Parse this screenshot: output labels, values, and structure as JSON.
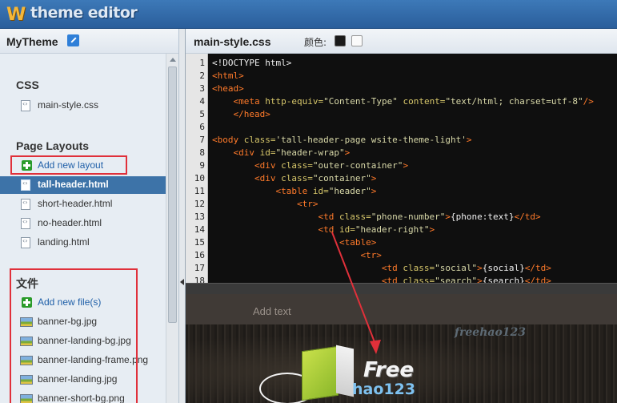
{
  "app": {
    "logo_letter": "W",
    "logo_text": "theme editor"
  },
  "sidebar": {
    "theme_name": "MyTheme",
    "sections": {
      "css": {
        "title": "CSS",
        "files": [
          {
            "label": "main-style.css",
            "icon": "code-file-icon"
          }
        ]
      },
      "layouts": {
        "title": "Page Layouts",
        "add_label": "Add new layout",
        "files": [
          {
            "label": "tall-header.html",
            "active": true
          },
          {
            "label": "short-header.html"
          },
          {
            "label": "no-header.html"
          },
          {
            "label": "landing.html"
          }
        ]
      },
      "files": {
        "title": "文件",
        "add_label": "Add new file(s)",
        "files": [
          {
            "label": "banner-bg.jpg"
          },
          {
            "label": "banner-landing-bg.jpg"
          },
          {
            "label": "banner-landing-frame.png"
          },
          {
            "label": "banner-landing.jpg"
          },
          {
            "label": "banner-short-bg.png"
          }
        ]
      }
    }
  },
  "editor": {
    "file_title": "main-style.css",
    "color_label": "颜色:",
    "swatches": [
      "#1a1a1a",
      "#fafafa"
    ],
    "lines": [
      {
        "n": "1",
        "indent": "",
        "tokens": [
          {
            "t": "<!DOCTYPE html>",
            "c": "plain"
          }
        ]
      },
      {
        "n": "2",
        "indent": "",
        "tokens": [
          {
            "t": "<html>",
            "c": "tag"
          }
        ]
      },
      {
        "n": "3",
        "indent": "",
        "tokens": [
          {
            "t": "<head>",
            "c": "tag"
          }
        ]
      },
      {
        "n": "4",
        "indent": "    ",
        "tokens": [
          {
            "t": "<meta",
            "c": "tag"
          },
          {
            "t": " http-equiv=",
            "c": "attr"
          },
          {
            "t": "\"Content-Type\"",
            "c": "val"
          },
          {
            "t": " content=",
            "c": "attr"
          },
          {
            "t": "\"text/html; charset=utf-8\"",
            "c": "val"
          },
          {
            "t": "/>",
            "c": "tag"
          }
        ]
      },
      {
        "n": "5",
        "indent": "    ",
        "tokens": [
          {
            "t": "</head>",
            "c": "tag"
          }
        ]
      },
      {
        "n": "6",
        "indent": "",
        "tokens": []
      },
      {
        "n": "7",
        "indent": "",
        "tokens": [
          {
            "t": "<body",
            "c": "tag"
          },
          {
            "t": " class=",
            "c": "attr"
          },
          {
            "t": "'tall-header-page wsite-theme-light'",
            "c": "val"
          },
          {
            "t": ">",
            "c": "tag"
          }
        ]
      },
      {
        "n": "8",
        "indent": "    ",
        "tokens": [
          {
            "t": "<div",
            "c": "tag"
          },
          {
            "t": " id=",
            "c": "attr"
          },
          {
            "t": "\"header-wrap\"",
            "c": "val"
          },
          {
            "t": ">",
            "c": "tag"
          }
        ]
      },
      {
        "n": "9",
        "indent": "        ",
        "tokens": [
          {
            "t": "<div",
            "c": "tag"
          },
          {
            "t": " class=",
            "c": "attr"
          },
          {
            "t": "\"outer-container\"",
            "c": "val"
          },
          {
            "t": ">",
            "c": "tag"
          }
        ]
      },
      {
        "n": "10",
        "indent": "        ",
        "tokens": [
          {
            "t": "<div",
            "c": "tag"
          },
          {
            "t": " class=",
            "c": "attr"
          },
          {
            "t": "\"container\"",
            "c": "val"
          },
          {
            "t": ">",
            "c": "tag"
          }
        ]
      },
      {
        "n": "11",
        "indent": "            ",
        "tokens": [
          {
            "t": "<table",
            "c": "tag"
          },
          {
            "t": " id=",
            "c": "attr"
          },
          {
            "t": "\"header\"",
            "c": "val"
          },
          {
            "t": ">",
            "c": "tag"
          }
        ]
      },
      {
        "n": "12",
        "indent": "                ",
        "tokens": [
          {
            "t": "<tr>",
            "c": "tag"
          }
        ]
      },
      {
        "n": "13",
        "indent": "                    ",
        "tokens": [
          {
            "t": "<td",
            "c": "tag"
          },
          {
            "t": " class=",
            "c": "attr"
          },
          {
            "t": "\"phone-number\"",
            "c": "val"
          },
          {
            "t": ">",
            "c": "tag"
          },
          {
            "t": "{phone:text}",
            "c": "plain"
          },
          {
            "t": "</td>",
            "c": "tag"
          }
        ]
      },
      {
        "n": "14",
        "indent": "                    ",
        "tokens": [
          {
            "t": "<td",
            "c": "tag"
          },
          {
            "t": " id=",
            "c": "attr"
          },
          {
            "t": "\"header-right\"",
            "c": "val"
          },
          {
            "t": ">",
            "c": "tag"
          }
        ]
      },
      {
        "n": "15",
        "indent": "                        ",
        "tokens": [
          {
            "t": "<table>",
            "c": "tag"
          }
        ]
      },
      {
        "n": "16",
        "indent": "                            ",
        "tokens": [
          {
            "t": "<tr>",
            "c": "tag"
          }
        ]
      },
      {
        "n": "17",
        "indent": "                                ",
        "tokens": [
          {
            "t": "<td",
            "c": "tag"
          },
          {
            "t": " class=",
            "c": "attr"
          },
          {
            "t": "\"social\"",
            "c": "val"
          },
          {
            "t": ">",
            "c": "tag"
          },
          {
            "t": "{social}",
            "c": "plain"
          },
          {
            "t": "</td>",
            "c": "tag"
          }
        ]
      },
      {
        "n": "18",
        "indent": "                                ",
        "tokens": [
          {
            "t": "<td",
            "c": "tag"
          },
          {
            "t": " class=",
            "c": "attr"
          },
          {
            "t": "\"search\"",
            "c": "val"
          },
          {
            "t": ">",
            "c": "tag"
          },
          {
            "t": "{search}",
            "c": "plain"
          },
          {
            "t": "</td>",
            "c": "tag"
          }
        ]
      }
    ]
  },
  "preview": {
    "add_text": "Add text",
    "watermark": "freehao123",
    "brand_top": "Free",
    "brand_bottom": "hao123"
  },
  "colors": {
    "accent": "#3d73a8",
    "highlight_box": "#e0303a",
    "link": "#1f5fa8"
  }
}
